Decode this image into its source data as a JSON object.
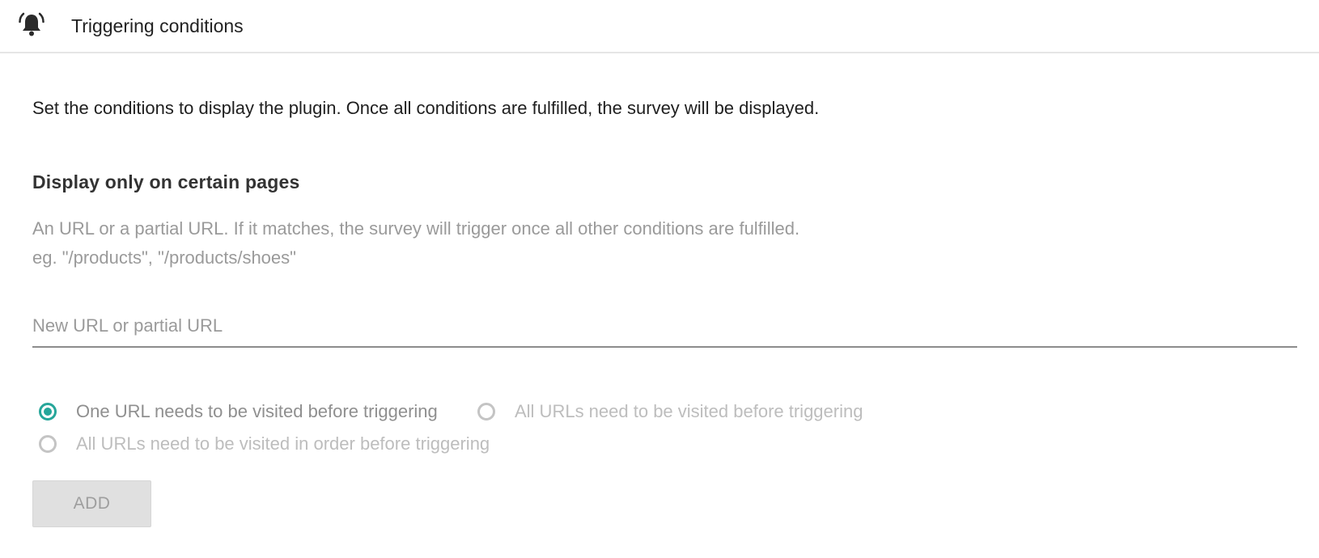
{
  "header": {
    "icon": "bell-icon",
    "title": "Triggering conditions"
  },
  "intro": "Set the conditions to display the plugin. Once all conditions are fulfilled, the survey will be displayed.",
  "section": {
    "title": "Display only on certain pages",
    "help_line1": "An URL or a partial URL. If it matches, the survey will trigger once all other conditions are fulfilled.",
    "help_line2": "eg. \"/products\", \"/products/shoes\""
  },
  "url_input": {
    "value": "",
    "placeholder": "New URL or partial URL"
  },
  "radios": [
    {
      "label": "One URL needs to be visited before triggering",
      "selected": true
    },
    {
      "label": "All URLs need to be visited before triggering",
      "selected": false
    },
    {
      "label": "All URLs need to be visited in order before triggering",
      "selected": false
    }
  ],
  "add_button": {
    "label": "ADD"
  },
  "colors": {
    "accent": "#26a69a",
    "disabled_text": "#bdbdbd",
    "button_bg": "#e0e0e0"
  }
}
